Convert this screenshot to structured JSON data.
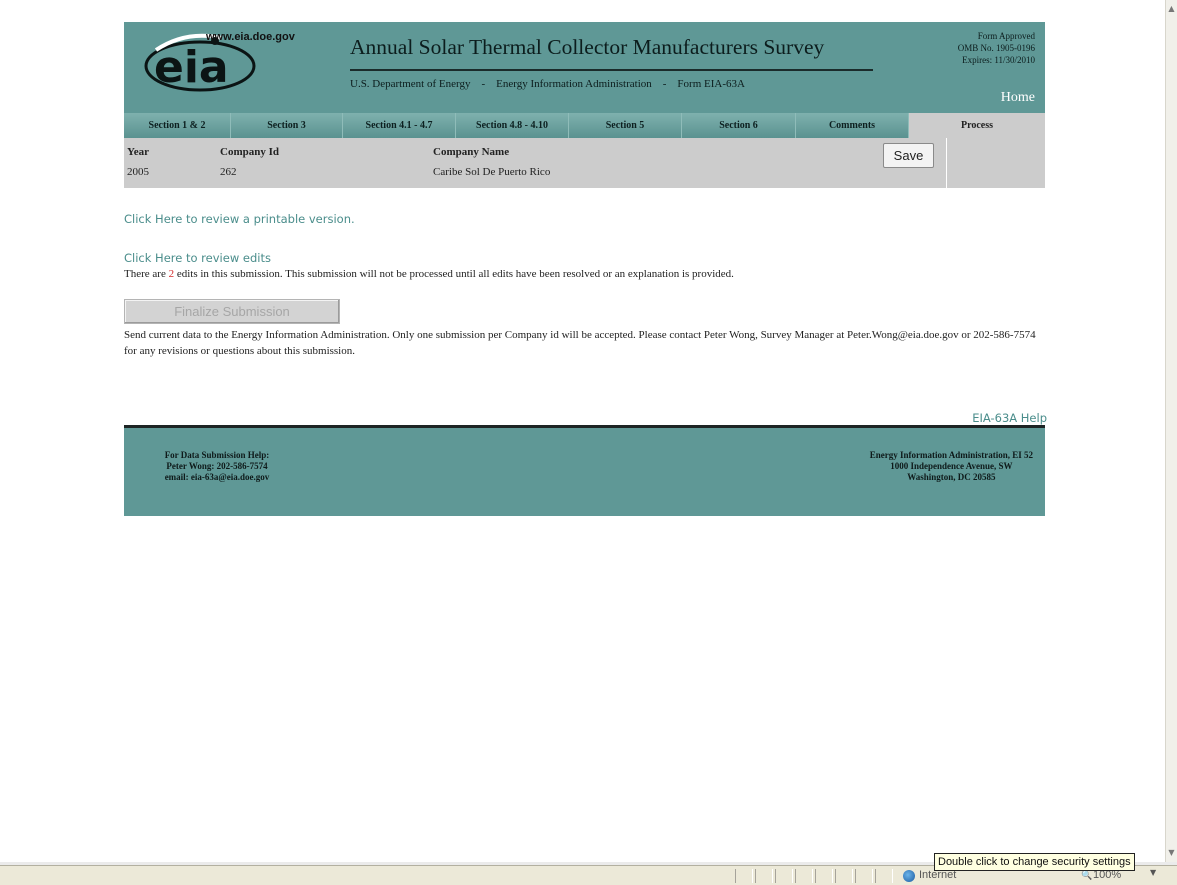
{
  "header": {
    "logo_text": "eia",
    "site_url": "www.eia.doe.gov",
    "title": "Annual Solar Thermal Collector Manufacturers Survey",
    "sub_dept": "U.S. Department of Energy",
    "sub_sep1": "-",
    "sub_agency": "Energy Information Administration",
    "sub_sep2": "-",
    "sub_form": "Form EIA-63A",
    "approval_line1": "Form Approved",
    "approval_line2": "OMB No. 1905-0196",
    "approval_line3": "Expires: 11/30/2010",
    "home_label": "Home"
  },
  "tabs": [
    {
      "label": "Section 1 & 2"
    },
    {
      "label": "Section 3"
    },
    {
      "label": "Section 4.1 - 4.7"
    },
    {
      "label": "Section 4.8 - 4.10"
    },
    {
      "label": "Section 5"
    },
    {
      "label": "Section 6"
    },
    {
      "label": "Comments"
    },
    {
      "label": "Process"
    }
  ],
  "info": {
    "year_label": "Year",
    "year_value": "2005",
    "company_id_label": "Company Id",
    "company_id_value": "262",
    "company_name_label": "Company Name",
    "company_name_value": "Caribe Sol De Puerto Rico",
    "save_label": "Save"
  },
  "body": {
    "printable_link": "Click Here to review a printable version.",
    "review_link": "Click Here to review edits",
    "edits_prefix": "There are ",
    "edits_count": "2",
    "edits_suffix": " edits in this submission. This submission will not be processed until all edits have been resolved or an explanation is provided.",
    "finalize_label": "Finalize Submission",
    "send_text": "Send current data to the Energy Information Administration. Only one submission per Company id will be accepted. Please contact Peter Wong, Survey Manager at Peter.Wong@eia.doe.gov or 202-586-7574 for any revisions or questions about this submission.",
    "help_link": "EIA-63A Help"
  },
  "footer": {
    "left_line1": "For Data Submission Help:",
    "left_line2": "Peter Wong: 202-586-7574",
    "left_line3": "email: eia-63a@eia.doe.gov",
    "right_line1": "Energy Information Administration, EI 52",
    "right_line2": "1000 Independence Avenue, SW",
    "right_line3": "Washington, DC 20585"
  },
  "statusbar": {
    "zone_label": "Internet",
    "zoom_label": "100%",
    "tooltip": "Double click to change security settings"
  },
  "colors": {
    "header_teal": "#5f9896",
    "link_teal": "#4a8d8b",
    "edit_count_red": "#d32b2b",
    "info_gray": "#cccccc"
  }
}
